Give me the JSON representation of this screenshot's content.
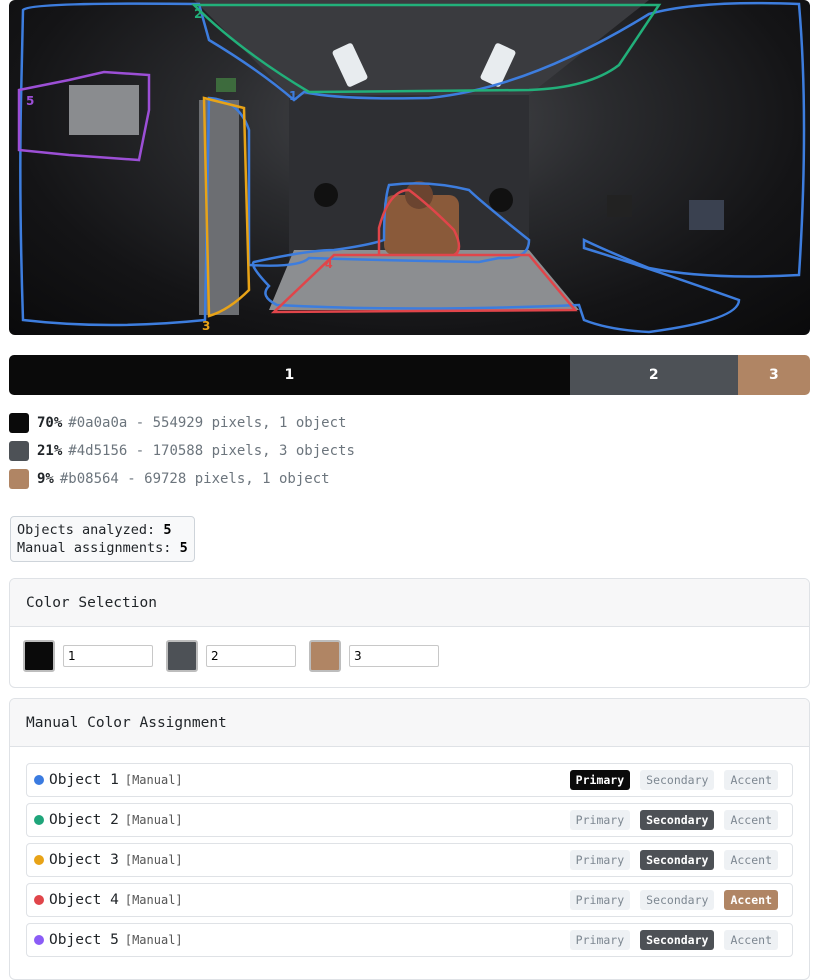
{
  "scene": {
    "outline_labels": [
      "1",
      "2",
      "3",
      "4",
      "5"
    ]
  },
  "bar": {
    "segments": [
      {
        "label": "1",
        "fraction": 0.7,
        "color": "#0a0a0a"
      },
      {
        "label": "2",
        "fraction": 0.21,
        "color": "#4d5156"
      },
      {
        "label": "3",
        "fraction": 0.09,
        "color": "#b08564"
      }
    ]
  },
  "legend": [
    {
      "pct": "70%",
      "text": "#0a0a0a - 554929 pixels, 1 object",
      "color": "#0a0a0a"
    },
    {
      "pct": "21%",
      "text": "#4d5156 - 170588 pixels, 3 objects",
      "color": "#4d5156"
    },
    {
      "pct": "9%",
      "text": "#b08564 - 69728 pixels, 1 object",
      "color": "#b08564"
    }
  ],
  "stats": {
    "objects_label": "Objects analyzed:",
    "objects_value": "5",
    "manual_label": "Manual assignments:",
    "manual_value": "5"
  },
  "color_selection": {
    "title": "Color Selection",
    "items": [
      {
        "value": "1",
        "color": "#0a0a0a"
      },
      {
        "value": "2",
        "color": "#4d5156"
      },
      {
        "value": "3",
        "color": "#b08564"
      }
    ]
  },
  "manual": {
    "title": "Manual Color Assignment",
    "buttons": {
      "primary": "Primary",
      "secondary": "Secondary",
      "accent": "Accent"
    },
    "objects": [
      {
        "name": "Object 1",
        "tag": "[Manual]",
        "dot": "#3b7be0",
        "selected": "primary"
      },
      {
        "name": "Object 2",
        "tag": "[Manual]",
        "dot": "#1fa57a",
        "selected": "secondary"
      },
      {
        "name": "Object 3",
        "tag": "[Manual]",
        "dot": "#e8a317",
        "selected": "secondary"
      },
      {
        "name": "Object 4",
        "tag": "[Manual]",
        "dot": "#e0454a",
        "selected": "accent"
      },
      {
        "name": "Object 5",
        "tag": "[Manual]",
        "dot": "#8b5cf6",
        "selected": "secondary"
      }
    ]
  }
}
